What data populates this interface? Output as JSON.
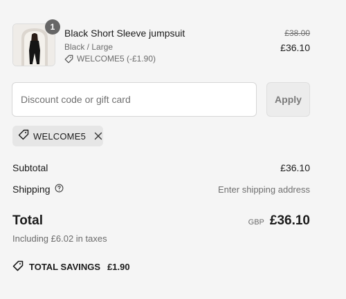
{
  "colors": {
    "background": "#f5f5f5",
    "badge": "#666666",
    "muted_text": "#6b6b6b",
    "apply_bg": "#ececec",
    "chip_bg": "#e6e6e6"
  },
  "product": {
    "image": "product-thumbnail",
    "quantity": "1",
    "name": "Black Short Sleeve jumpsuit",
    "variant": "Black / Large",
    "discount_icon": "tag-icon",
    "discount_text": "WELCOME5 (-£1.90)",
    "original_price": "£38.00",
    "price": "£36.10"
  },
  "discount": {
    "placeholder": "Discount code or gift card",
    "value": "",
    "apply_label": "Apply",
    "applied_code": "WELCOME5",
    "remove_icon": "close-icon"
  },
  "summary": {
    "subtotal_label": "Subtotal",
    "subtotal_value": "£36.10",
    "shipping_label": "Shipping",
    "shipping_help_icon": "question-circle-icon",
    "shipping_value": "Enter shipping address",
    "total_label": "Total",
    "currency": "GBP",
    "total_value": "£36.10",
    "taxes_text": "Including £6.02 in taxes",
    "savings_icon": "tag-icon",
    "savings_label": "TOTAL SAVINGS",
    "savings_value": "£1.90"
  }
}
